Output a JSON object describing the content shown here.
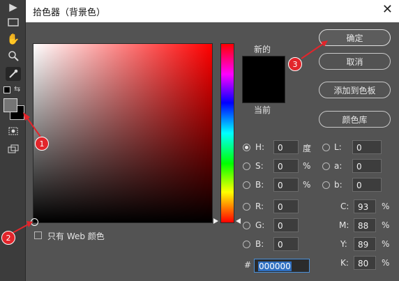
{
  "dialog": {
    "title": "拾色器（背景色）",
    "close": "✕",
    "new_label": "新的",
    "current_label": "当前",
    "web_colors_label": "只有 Web 颜色",
    "buttons": {
      "ok": "确定",
      "cancel": "取消",
      "add_swatch": "添加到色板",
      "libraries": "颜色库"
    },
    "hsb": {
      "h": {
        "label": "H:",
        "value": "0",
        "unit": "度"
      },
      "s": {
        "label": "S:",
        "value": "0",
        "unit": "%"
      },
      "b": {
        "label": "B:",
        "value": "0",
        "unit": "%"
      }
    },
    "lab": {
      "l": {
        "label": "L:",
        "value": "0"
      },
      "a": {
        "label": "a:",
        "value": "0"
      },
      "b": {
        "label": "b:",
        "value": "0"
      }
    },
    "rgb": {
      "r": {
        "label": "R:",
        "value": "0"
      },
      "g": {
        "label": "G:",
        "value": "0"
      },
      "b": {
        "label": "B:",
        "value": "0"
      }
    },
    "cmyk": {
      "c": {
        "label": "C:",
        "value": "93",
        "unit": "%"
      },
      "m": {
        "label": "M:",
        "value": "88",
        "unit": "%"
      },
      "y": {
        "label": "Y:",
        "value": "89",
        "unit": "%"
      },
      "k": {
        "label": "K:",
        "value": "80",
        "unit": "%"
      }
    },
    "hex": {
      "label": "#",
      "value": "000000"
    }
  },
  "colors": {
    "new_swatch": "#000000",
    "current_swatch": "#000000",
    "hue": "#ff0000",
    "accent": "#e2252b"
  },
  "annotations": [
    "1",
    "2",
    "3"
  ],
  "toolbar_icons": [
    "move-arrow-icon",
    "marquee-icon",
    "hand-icon",
    "zoom-icon",
    "eyedropper-icon",
    "swap-colors-icon",
    "quick-mask-icon",
    "screen-mode-icon"
  ]
}
